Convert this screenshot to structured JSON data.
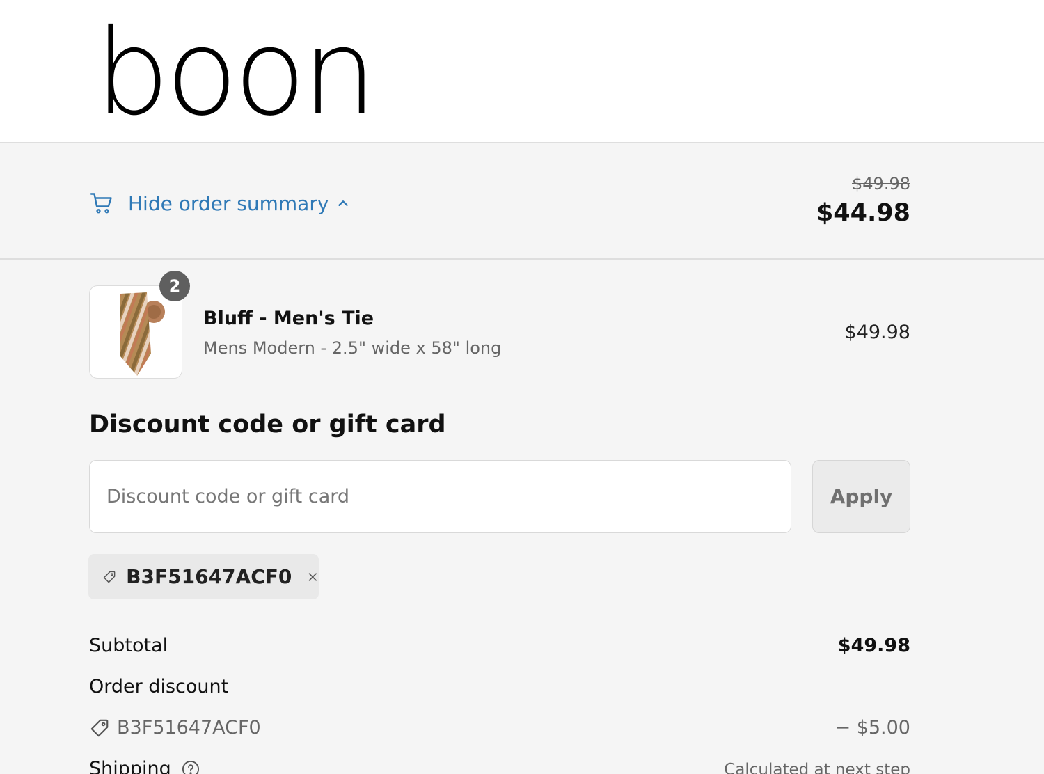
{
  "brand": {
    "logo_text": "boon"
  },
  "summary_bar": {
    "toggle_label": "Hide order summary",
    "original_total": "$49.98",
    "total": "$44.98"
  },
  "line_item": {
    "quantity": "2",
    "title": "Bluff - Men's Tie",
    "variant": "Mens Modern - 2.5\" wide x 58\" long",
    "price": "$49.98"
  },
  "discount": {
    "heading": "Discount code or gift card",
    "input_placeholder": "Discount code or gift card",
    "input_value": "",
    "apply_label": "Apply",
    "applied_code": "B3F51647ACF0"
  },
  "totals": {
    "subtotal_label": "Subtotal",
    "subtotal_value": "$49.98",
    "order_discount_label": "Order discount",
    "discount_code": "B3F51647ACF0",
    "discount_value": "− $5.00",
    "shipping_label": "Shipping",
    "shipping_value": "Calculated at next step"
  },
  "colors": {
    "link": "#2f79b6",
    "background": "#f5f5f5",
    "badge": "#5f5f5f"
  },
  "icons": [
    "cart-icon",
    "chevron-up-icon",
    "tag-icon",
    "close-icon",
    "help-icon"
  ]
}
